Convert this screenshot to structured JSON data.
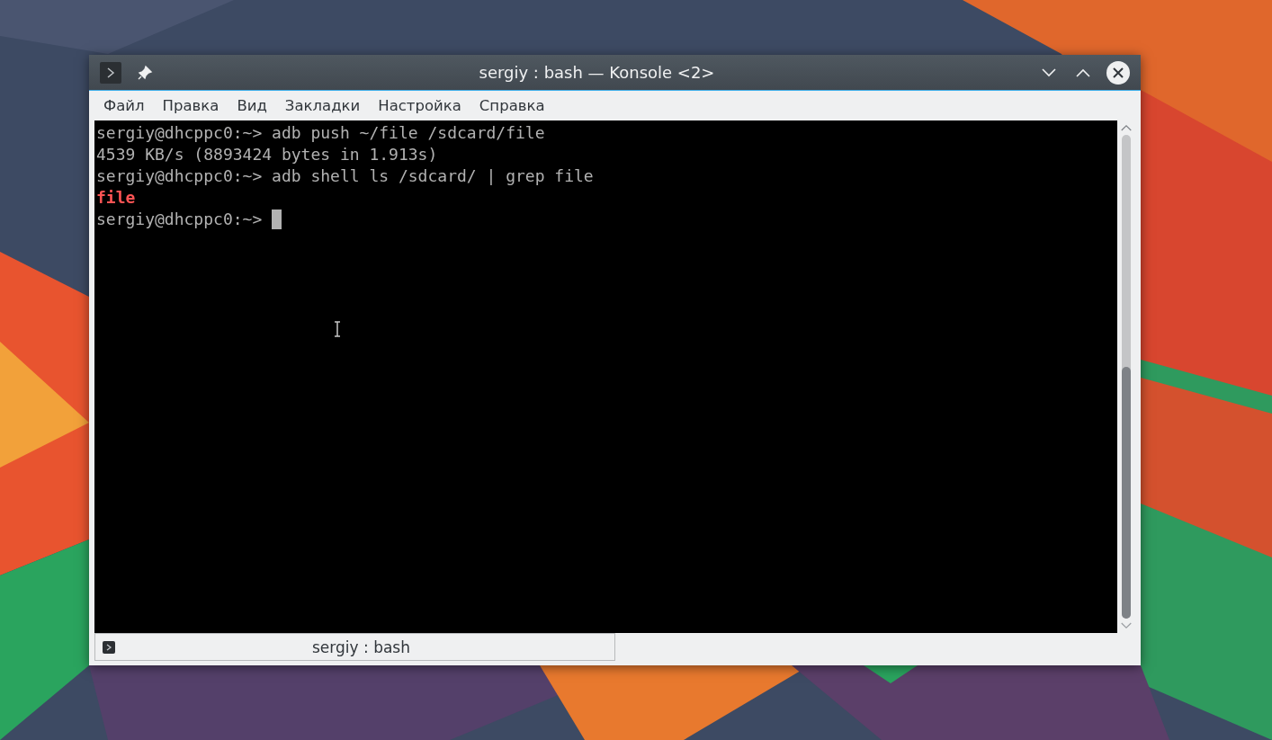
{
  "window": {
    "title": "sergiy : bash — Konsole <2>"
  },
  "menu": [
    "Файл",
    "Правка",
    "Вид",
    "Закладки",
    "Настройка",
    "Справка"
  ],
  "terminal": {
    "lines": [
      {
        "kind": "output",
        "text": "sergiy@dhcppc0:~> adb push ~/file /sdcard/file"
      },
      {
        "kind": "output",
        "text": "4539 KB/s (8893424 bytes in 1.913s)"
      },
      {
        "kind": "output",
        "text": "sergiy@dhcppc0:~> adb shell ls /sdcard/ | grep file"
      },
      {
        "kind": "match",
        "text": "file"
      },
      {
        "kind": "prompt",
        "text": "sergiy@dhcppc0:~>"
      }
    ]
  },
  "tabs": [
    {
      "label": "sergiy : bash",
      "selected": true
    }
  ]
}
